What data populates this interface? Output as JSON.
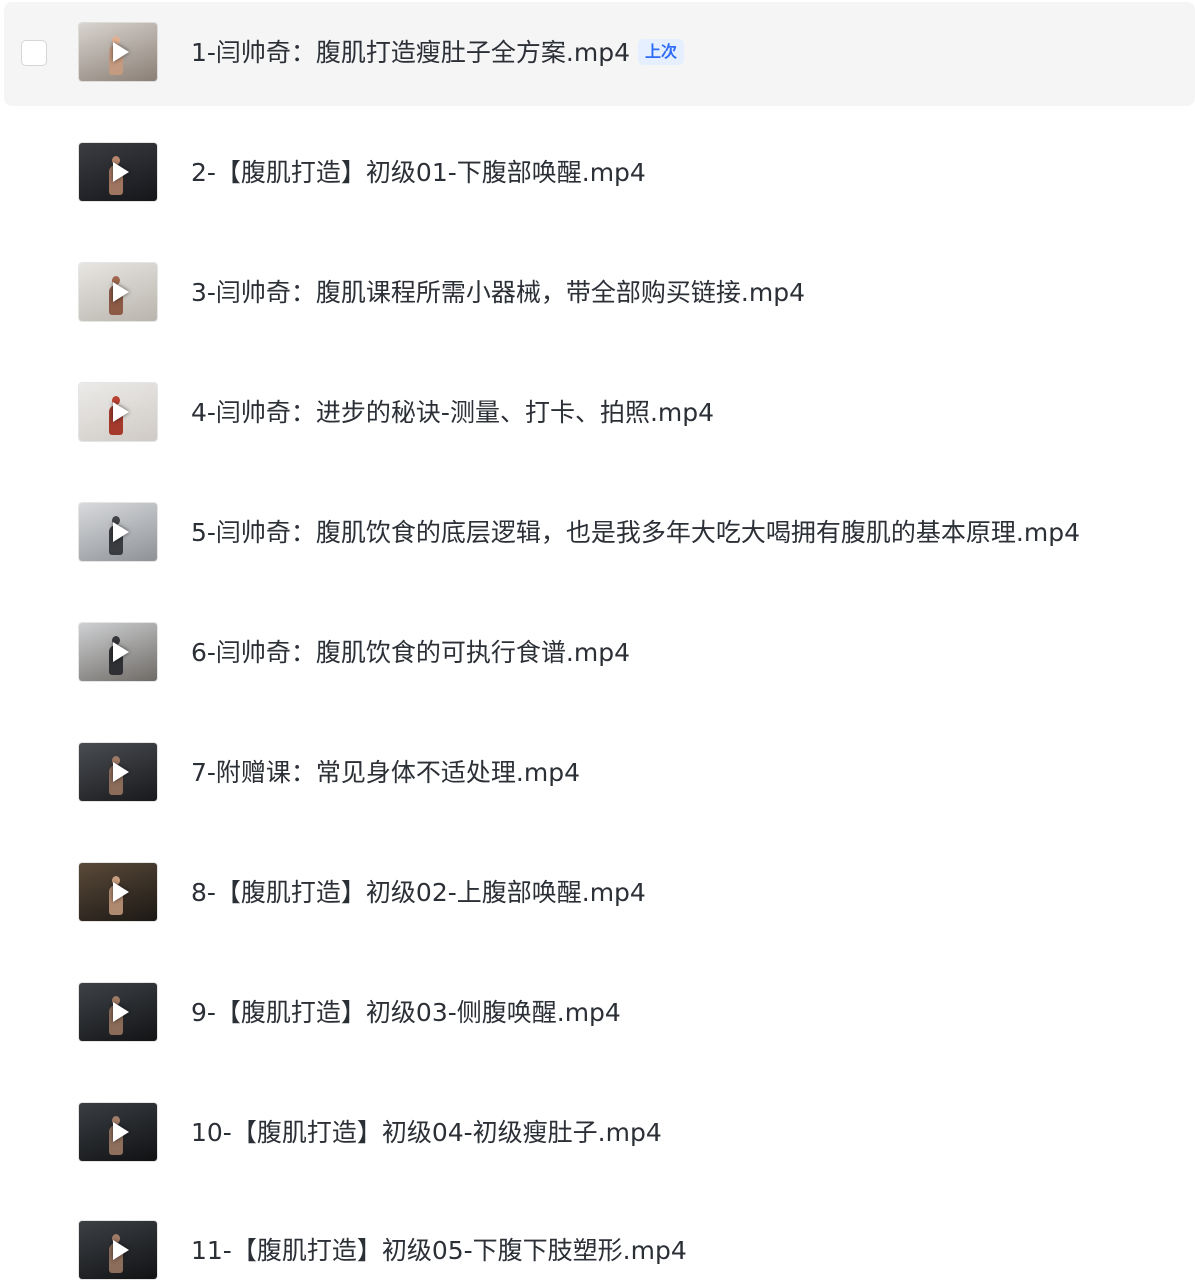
{
  "files": [
    {
      "name": "1-闫帅奇：腹肌打造瘦肚子全方案.mp4",
      "badge": "上次",
      "selected": true,
      "thumb": {
        "bg": [
          "#d9d4cf",
          "#8a7f76"
        ],
        "figure": "#c49a80"
      }
    },
    {
      "name": "2-【腹肌打造】初级01-下腹部唤醒.mp4",
      "thumb": {
        "bg": [
          "#3b3d42",
          "#15161a"
        ],
        "figure": "#a07560"
      }
    },
    {
      "name": "3-闫帅奇：腹肌课程所需小器械，带全部购买链接.mp4",
      "thumb": {
        "bg": [
          "#e8e6e2",
          "#b9b4ad"
        ],
        "figure": "#8c5a45"
      }
    },
    {
      "name": "4-闫帅奇：进步的秘诀-测量、打卡、拍照.mp4",
      "thumb": {
        "bg": [
          "#ecebe9",
          "#cfcac5"
        ],
        "figure": "#a33a2c"
      }
    },
    {
      "name": "5-闫帅奇：腹肌饮食的底层逻辑，也是我多年大吃大喝拥有腹肌的基本原理.mp4",
      "thumb": {
        "bg": [
          "#d8dadd",
          "#8e9196"
        ],
        "figure": "#3a3c40"
      }
    },
    {
      "name": "6-闫帅奇：腹肌饮食的可执行食谱.mp4",
      "thumb": {
        "bg": [
          "#cfd1d3",
          "#6e6a66"
        ],
        "figure": "#2f3033"
      }
    },
    {
      "name": "7-附赠课：常见身体不适处理.mp4",
      "thumb": {
        "bg": [
          "#4a4d52",
          "#18191c"
        ],
        "figure": "#8b6b5a"
      }
    },
    {
      "name": "8-【腹肌打造】初级02-上腹部唤醒.mp4",
      "thumb": {
        "bg": [
          "#5a4a3a",
          "#1c1814"
        ],
        "figure": "#b08a70"
      }
    },
    {
      "name": "9-【腹肌打造】初级03-侧腹唤醒.mp4",
      "thumb": {
        "bg": [
          "#3e4247",
          "#121315"
        ],
        "figure": "#8a6a58"
      }
    },
    {
      "name": "10-【腹肌打造】初级04-初级瘦肚子.mp4",
      "thumb": {
        "bg": [
          "#3a3e43",
          "#101113"
        ],
        "figure": "#8e6e5c"
      }
    },
    {
      "name": "11-【腹肌打造】初级05-下腹下肢塑形.mp4",
      "thumb": {
        "bg": [
          "#3c4045",
          "#111214"
        ],
        "figure": "#8c6c5a"
      }
    }
  ]
}
